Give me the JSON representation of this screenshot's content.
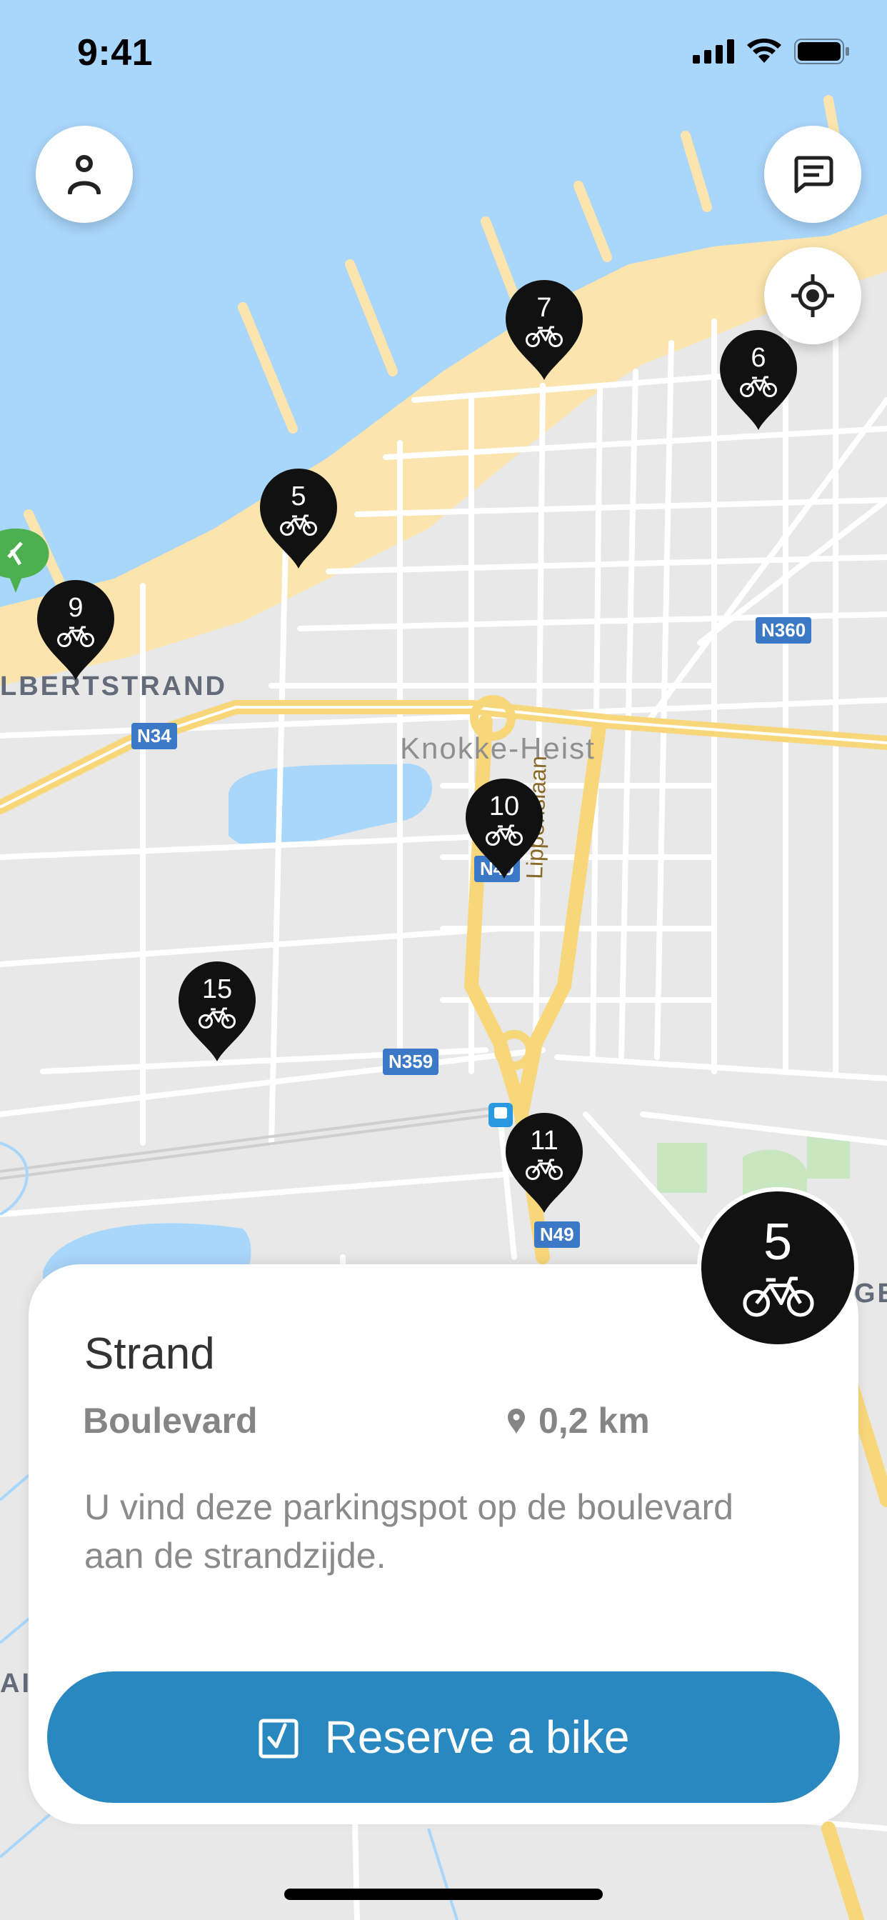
{
  "status_bar": {
    "time": "9:41"
  },
  "map": {
    "labels": {
      "place_albertstrand": "LBERTSTRAND",
      "place_knokke": "Knokke-Heist",
      "street_lippenslaan": "Lippenslaan",
      "edge_right": "GE",
      "edge_left": "AI"
    },
    "road_shields": [
      "N34",
      "N360",
      "N49",
      "N359",
      "N49"
    ],
    "pins": [
      {
        "count": "7",
        "icon": "bike-icon"
      },
      {
        "count": "6",
        "icon": "bike-icon"
      },
      {
        "count": "5",
        "icon": "bike-icon"
      },
      {
        "count": "9",
        "icon": "bike-icon"
      },
      {
        "count": "10",
        "icon": "bike-icon"
      },
      {
        "count": "15",
        "icon": "bike-icon"
      },
      {
        "count": "11",
        "icon": "bike-icon"
      }
    ]
  },
  "buttons": {
    "profile_icon": "person-icon",
    "messages_icon": "chat-icon",
    "locate_icon": "locate-icon"
  },
  "selected": {
    "count": "5",
    "title": "Strand",
    "subtitle": "Boulevard",
    "distance": "0,2 km",
    "description": "U vind deze parkingspot op de boulevard aan de strandzijde.",
    "reserve_label": "Reserve a bike"
  },
  "colors": {
    "sea": "#a9d6fb",
    "beach": "#fbe4ad",
    "pin": "#111111",
    "accent": "#2a88c1",
    "road_major": "#f8d77a"
  }
}
